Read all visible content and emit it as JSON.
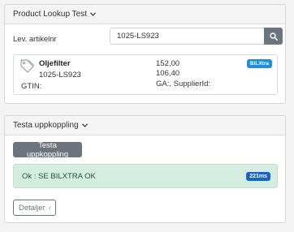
{
  "lookup_panel": {
    "title": "Product Lookup Test",
    "field_label": "Lev. artikelnr",
    "field_value": "1025-LS923",
    "result": {
      "name": "Oljefilter",
      "code": "1025-LS923",
      "gtin_label": "GTIN:",
      "price_1": "152,00",
      "price_2": "106,40",
      "ga_supplier": "GA:, SupplierId:",
      "source_badge": "BILXtra",
      "icon": "tag-icon"
    }
  },
  "connection_panel": {
    "title": "Testa uppkoppling",
    "test_button": "Testa uppkoppling",
    "status_message": "Ok : SE BILXTRA OK",
    "response_time": "221ms",
    "details_button": "Detaljer"
  },
  "colors": {
    "source_badge": "#1a8fe0",
    "time_badge": "#1565c0",
    "success_bg": "#d4ede0",
    "button_gray": "#6c757d"
  }
}
